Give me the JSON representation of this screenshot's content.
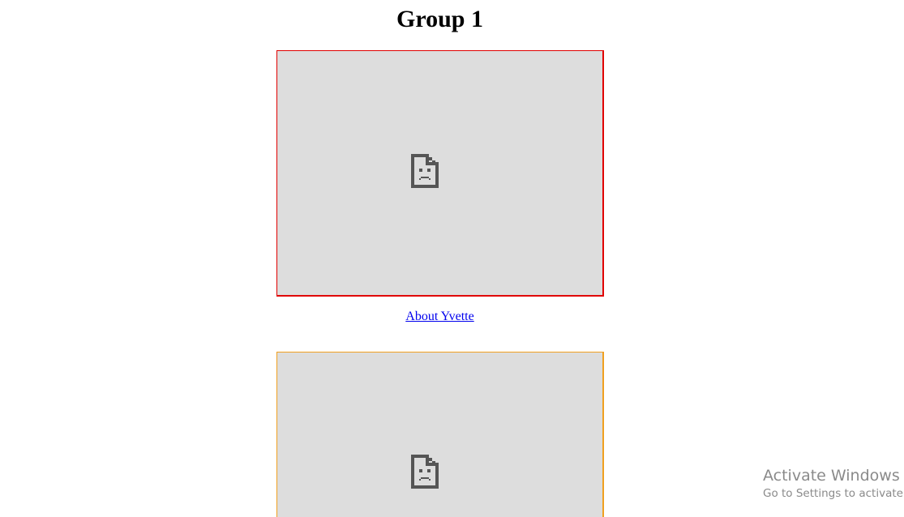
{
  "page": {
    "title": "Group 1"
  },
  "frames": [
    {
      "border_color": "#e00000",
      "icon": "sad-page-icon"
    },
    {
      "border_color": "#f0a020",
      "icon": "sad-page-icon"
    }
  ],
  "link": {
    "text": "About Yvette"
  },
  "watermark": {
    "title": "Activate Windows",
    "subtitle": "Go to Settings to activate W"
  }
}
